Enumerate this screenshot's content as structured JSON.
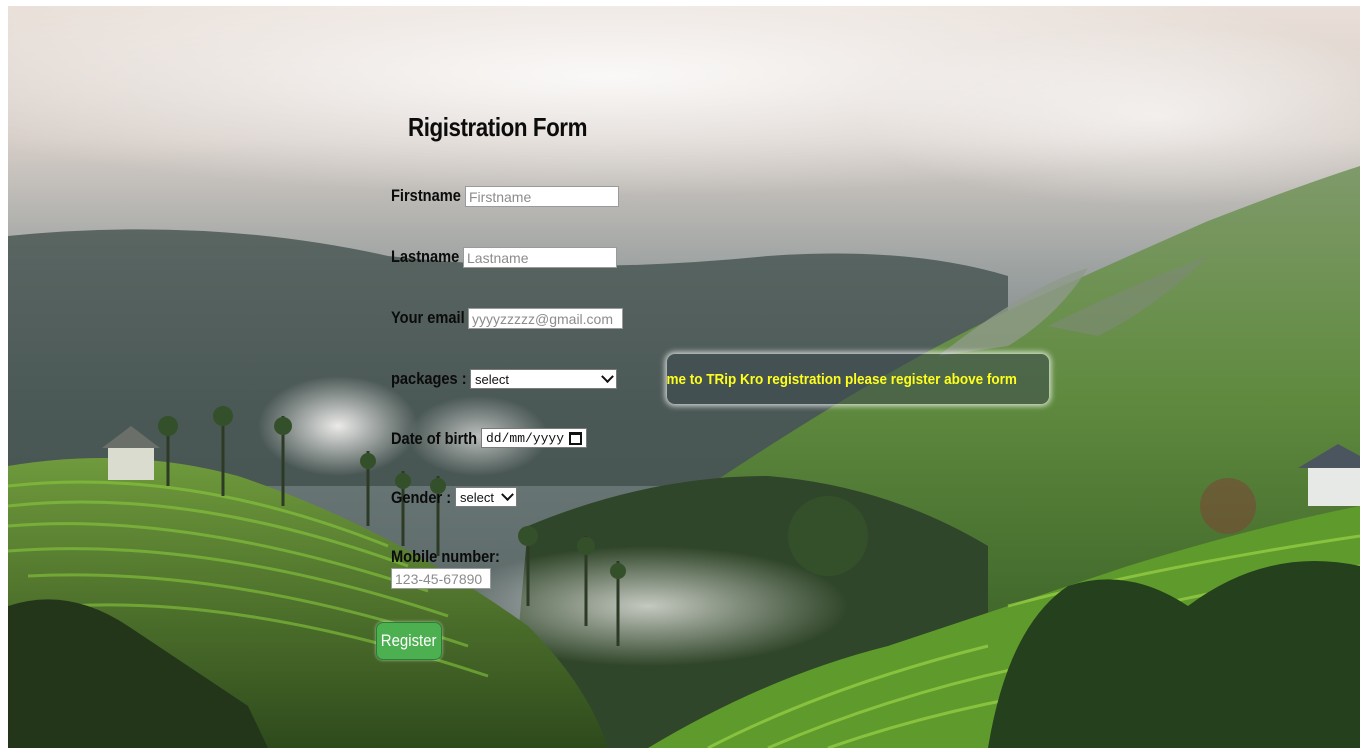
{
  "form": {
    "title": "Rigistration Form",
    "firstname": {
      "label": "Firstname",
      "placeholder": "Firstname"
    },
    "lastname": {
      "label": "Lastname",
      "placeholder": "Lastname"
    },
    "email": {
      "label": "Your email",
      "placeholder": "yyyyzzzzz@gmail.com"
    },
    "packages": {
      "label": "packages :",
      "selected": "select"
    },
    "dob": {
      "label": "Date of birth",
      "placeholder": "dd/mm/yyyy"
    },
    "gender": {
      "label": "Gender :",
      "selected": "select"
    },
    "mobile": {
      "label": "Mobile number:",
      "placeholder": "123-45-67890"
    },
    "register_label": "Register"
  },
  "banner": {
    "text": "Welcome to TRip Kro registration please register above form"
  },
  "colors": {
    "banner_text": "#ffff1e",
    "button_bg": "#4caf50",
    "label_text": "#0b0b0b"
  },
  "icons": {
    "dropdown": "chevron-down-icon",
    "date": "calendar-icon"
  }
}
